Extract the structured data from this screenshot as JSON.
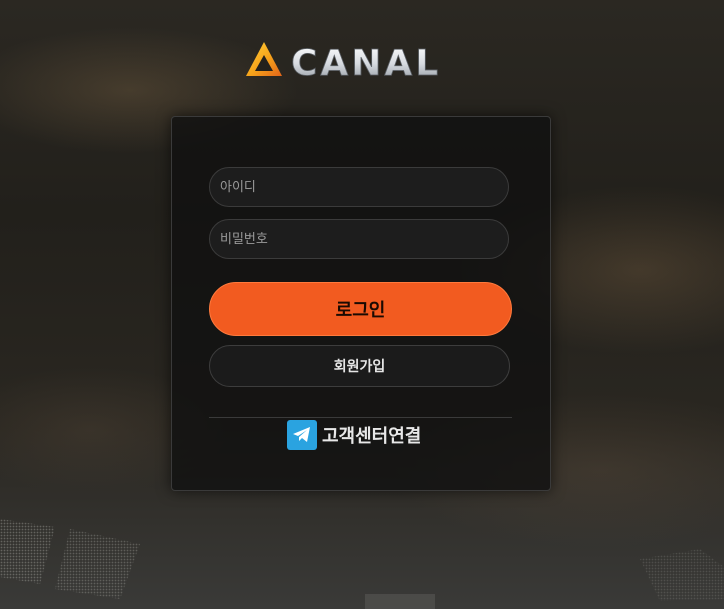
{
  "brand": {
    "name": "CANAL"
  },
  "login": {
    "id_placeholder": "아이디",
    "password_placeholder": "비밀번호",
    "login_button_label": "로그인",
    "signup_button_label": "회원가입",
    "support_link_label": "고객센터연결",
    "support_icon": "telegram-icon"
  },
  "colors": {
    "accent": "#f25b20",
    "telegram": "#2aa3e0"
  }
}
